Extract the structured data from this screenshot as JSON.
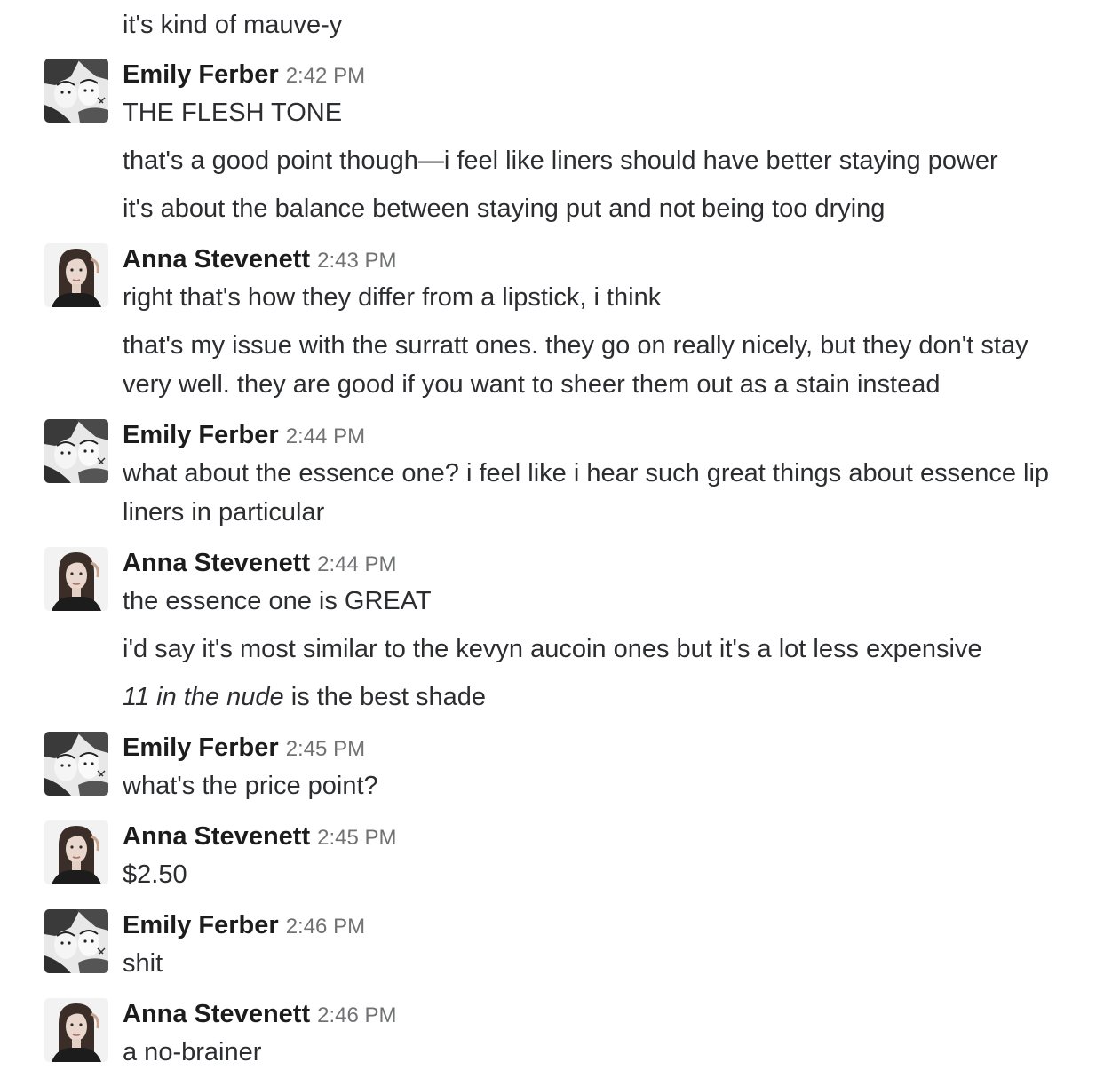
{
  "users": {
    "emily": {
      "name": "Emily Ferber",
      "avatar_icon": "emily-ferber-avatar-icon"
    },
    "anna": {
      "name": "Anna Stevenett",
      "avatar_icon": "anna-stevenett-avatar-icon"
    }
  },
  "messages": [
    {
      "lines": [
        "it's kind of mauve-y"
      ]
    },
    {
      "author": "Emily Ferber",
      "time": "2:42 PM",
      "lines": [
        "THE FLESH TONE",
        "that's a good point though—i feel like liners should have better staying power",
        "it's about the balance between staying put and not being too drying"
      ]
    },
    {
      "author": "Anna Stevenett",
      "time": "2:43 PM",
      "lines": [
        "right that's how they differ from a lipstick, i think",
        "that's my issue with the surratt ones. they go on really nicely, but they don't stay very well. they are good if you want to sheer them out as a stain instead"
      ]
    },
    {
      "author": "Emily Ferber",
      "time": "2:44 PM",
      "lines": [
        "what about the essence one? i feel like i hear such great things about essence lip liners in particular"
      ]
    },
    {
      "author": "Anna Stevenett",
      "time": "2:44 PM",
      "lines": [
        "the essence one is GREAT",
        "i'd say it's most similar to the kevyn aucoin ones but it's a lot less expensive"
      ],
      "shade_line": {
        "italic": "11 in the nude",
        "rest": " is the best shade"
      }
    },
    {
      "author": "Emily Ferber",
      "time": "2:45 PM",
      "lines": [
        "what's the price point?"
      ]
    },
    {
      "author": "Anna Stevenett",
      "time": "2:45 PM",
      "lines": [
        "$2.50"
      ]
    },
    {
      "author": "Emily Ferber",
      "time": "2:46 PM",
      "lines": [
        "shit"
      ]
    },
    {
      "author": "Anna Stevenett",
      "time": "2:46 PM",
      "lines": [
        "a no-brainer"
      ]
    }
  ]
}
